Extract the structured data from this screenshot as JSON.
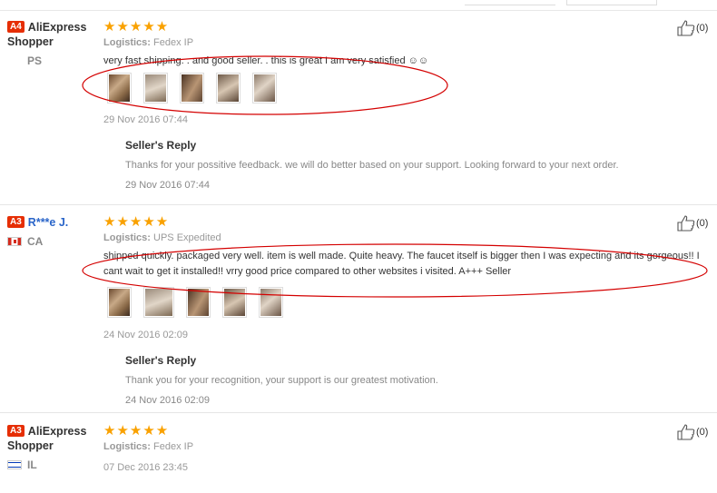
{
  "reviews": [
    {
      "badge": "A4",
      "username": "AliExpress Shopper",
      "country": "PS",
      "stars": "★★★★★",
      "logistics_label": "Logistics:",
      "logistics": "Fedex IP",
      "text": "very fast shipping. . and good seller. . this is great I am very satisfied ☺☺",
      "date": "29 Nov 2016 07:44",
      "helpful": "(0)",
      "reply_title": "Seller's Reply",
      "reply_text": "Thanks for your possitive feedback. we will do better based on your support. Looking forward to your next order.",
      "reply_date": "29 Nov 2016 07:44"
    },
    {
      "badge": "A3",
      "username": "R***e J.",
      "country": "CA",
      "stars": "★★★★★",
      "logistics_label": "Logistics:",
      "logistics": "UPS Expedited",
      "text": "shipped quickly. packaged very well. item is well made. Quite heavy. The faucet itself is bigger then I was expecting and its gorgeous!! I cant wait to get it installed!! vrry good price compared to other websites i visited. A+++ Seller",
      "date": "24 Nov 2016 02:09",
      "helpful": "(0)",
      "reply_title": "Seller's Reply",
      "reply_text": "Thank you for your recognition, your support is our greatest motivation.",
      "reply_date": "24 Nov 2016 02:09"
    },
    {
      "badge": "A3",
      "username": "AliExpress Shopper",
      "country": "IL",
      "stars": "★★★★★",
      "logistics_label": "Logistics:",
      "logistics": "Fedex IP",
      "date": "07 Dec 2016 23:45",
      "helpful": "(0)"
    }
  ],
  "colors": {
    "accent_red": "#e62e04",
    "star": "#f9a100",
    "link": "#2a65c9",
    "annotation": "#d40000"
  },
  "icons": {
    "helpful": "thumbs-up-icon"
  }
}
